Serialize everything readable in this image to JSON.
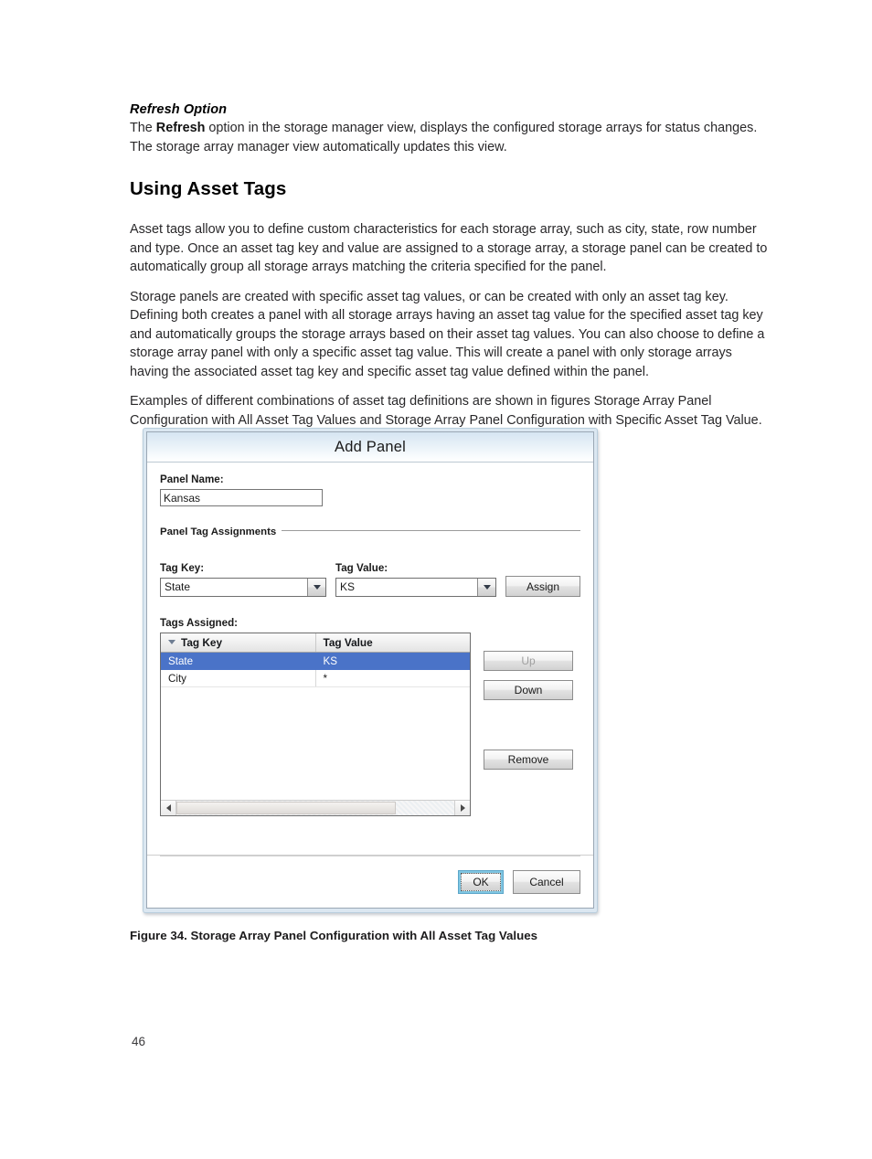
{
  "document": {
    "sub_heading": "Refresh Option",
    "refresh_para_1": "The ",
    "refresh_para_bold": "Refresh",
    "refresh_para_2": " option in the storage manager view, displays the configured storage arrays for status changes. The storage array manager view automatically updates this view.",
    "section_title": "Using Asset Tags",
    "para_1": "Asset tags allow you to define custom characteristics for each storage array, such as city, state, row number and type. Once an asset tag key and value are assigned to a storage array, a storage panel can be created to automatically group all storage arrays matching the criteria specified for the panel.",
    "para_2": "Storage panels are created with specific asset tag values, or can be created with only an asset tag key. Defining both creates a panel with all storage arrays having an asset tag value for the specified asset tag key and automatically groups the storage arrays based on their asset tag values. You can also choose to define a storage array panel with only a specific asset tag value. This will create a panel with only storage arrays having the associated asset tag key and specific asset tag value defined within the panel.",
    "para_3": "Examples of different combinations of asset tag definitions are shown in figures Storage Array Panel Configuration with All Asset Tag Values and Storage Array Panel Configuration with Specific Asset Tag Value.",
    "figure_caption": "Figure 34. Storage Array Panel Configuration with All Asset Tag Values",
    "page_number": "46"
  },
  "dialog": {
    "title": "Add Panel",
    "panel_name_label": "Panel Name:",
    "panel_name_value": "Kansas",
    "panel_name_placeholder": "",
    "group_title": "Panel Tag Assignments",
    "tag_key_label": "Tag Key:",
    "tag_key_value": "State",
    "tag_value_label": "Tag Value:",
    "tag_value_value": "KS",
    "assign_label": "Assign",
    "tags_assigned_label": "Tags Assigned:",
    "table": {
      "columns": [
        "Tag Key",
        "Tag Value"
      ],
      "sorted_column": "Tag Key",
      "sort_direction": "descending",
      "rows": [
        {
          "tag_key": "State",
          "tag_value": "KS",
          "selected": true
        },
        {
          "tag_key": "City",
          "tag_value": "*",
          "selected": false
        }
      ]
    },
    "scrollbar": {
      "left_arrow": "left-arrow",
      "right_arrow": "right-arrow",
      "thumb_percent": "79"
    },
    "up_label": "Up",
    "up_disabled": true,
    "down_label": "Down",
    "remove_label": "Remove",
    "ok_label": "OK",
    "cancel_label": "Cancel"
  },
  "colors": {
    "selection_blue": "#4a73c8",
    "focus_ring_blue": "#7fc6e2",
    "titlebar_blue": "#d6e5f2",
    "window_frame": "#dbe7f1"
  }
}
